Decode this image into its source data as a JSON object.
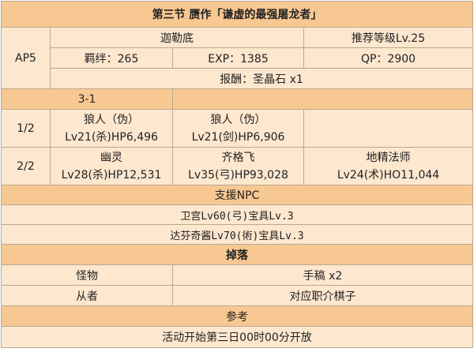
{
  "title": "第三节 赝作「谦虚的最强屠龙者」",
  "quest": {
    "ap": "AP5",
    "location": "迦勒底",
    "recommended_level": "推荐等级Lv.25",
    "bond": "羁绊：265",
    "exp": "EXP：1385",
    "qp": "QP：2900",
    "reward": "报酬：圣晶石 x1"
  },
  "battle": {
    "stage_label": "3-1",
    "waves": [
      {
        "label": "1/2",
        "enemies": [
          {
            "name": "狼人（伪）",
            "stats": "Lv21(杀)HP6,496"
          },
          {
            "name": "狼人（伪）",
            "stats": "Lv21(剑)HP6,906"
          }
        ]
      },
      {
        "label": "2/2",
        "enemies": [
          {
            "name": "幽灵",
            "stats": "Lv28(杀)HP12,531"
          },
          {
            "name": "齐格飞",
            "stats": "Lv35(弓)HP93,028"
          },
          {
            "name": "地精法师",
            "stats": "Lv24(术)HO11,044"
          }
        ]
      }
    ]
  },
  "support": {
    "header": "支援NPC",
    "entries": [
      "卫宫Lv60(弓)宝具Lv.3",
      "达芬奇酱Lv70(術)宝具Lv.3"
    ]
  },
  "drops": {
    "header": "掉落",
    "rows": [
      {
        "label": "怪物",
        "value": "手稿 x2"
      },
      {
        "label": "从者",
        "value": "对应职介棋子"
      }
    ]
  },
  "notes": {
    "header": "参考",
    "text": "活动开始第三日00时00分开放"
  }
}
